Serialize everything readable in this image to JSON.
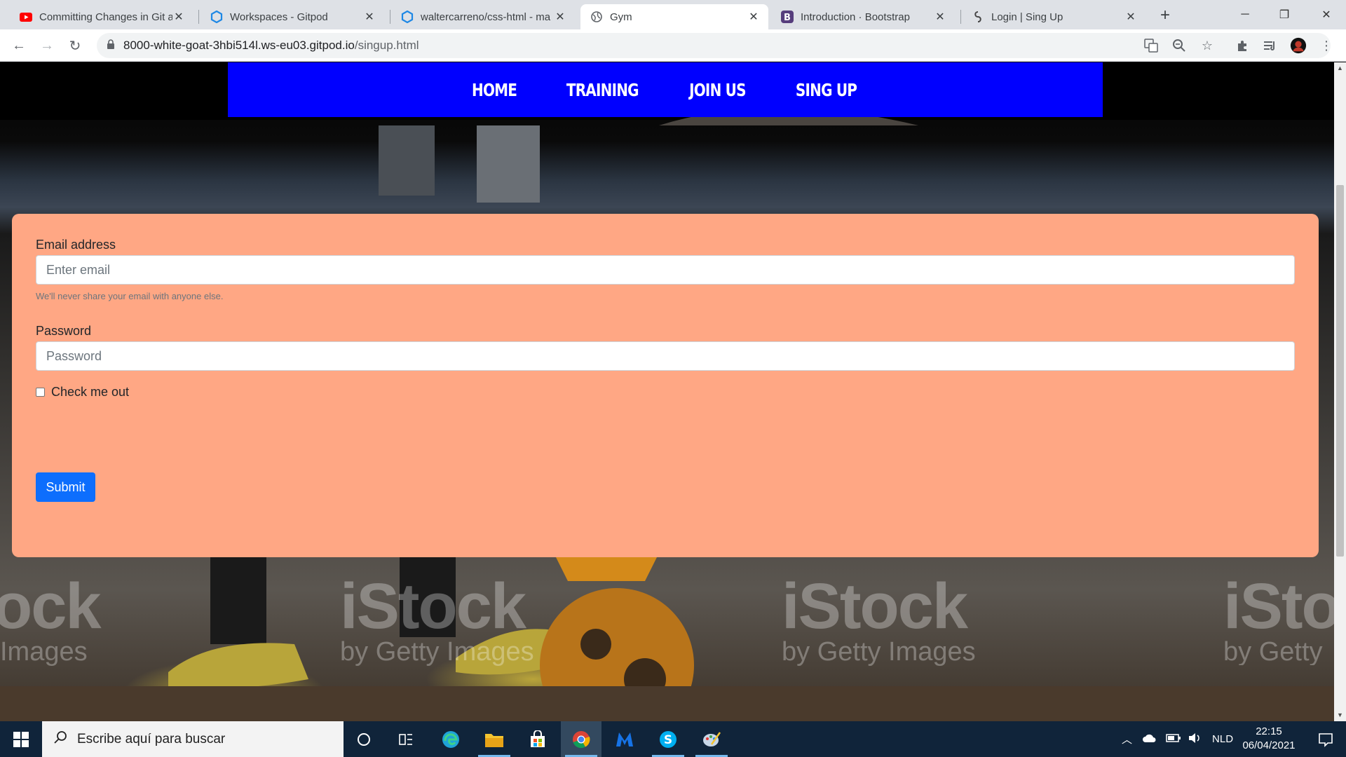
{
  "browser": {
    "tabs": [
      {
        "title": "Committing Changes in Git a",
        "icon": "youtube-icon",
        "active": false
      },
      {
        "title": "Workspaces - Gitpod",
        "icon": "gitpod-icon",
        "active": false
      },
      {
        "title": "waltercarreno/css-html - ma",
        "icon": "gitpod-icon",
        "active": false
      },
      {
        "title": "Gym",
        "icon": "globe-icon",
        "active": true
      },
      {
        "title": "Introduction · Bootstrap",
        "icon": "bootstrap-icon",
        "active": false
      },
      {
        "title": "Login | Sing Up",
        "icon": "site-icon",
        "active": false
      }
    ],
    "url_host": "8000-white-goat-3hbi514l.ws-eu03.gitpod.io",
    "url_path": "/singup.html"
  },
  "page": {
    "nav": [
      "HOME",
      "TRAINING",
      "JOIN US",
      "SING UP"
    ],
    "watermark_brand": "iStock",
    "watermark_sub": "by Getty Images",
    "form": {
      "email_label": "Email address",
      "email_placeholder": "Enter email",
      "email_help": "We'll never share your email with anyone else.",
      "password_label": "Password",
      "password_placeholder": "Password",
      "check_label": "Check me out",
      "submit_label": "Submit"
    },
    "colors": {
      "navbar": "#0000ff",
      "card": "#ffa784",
      "submit": "#0d6efd"
    }
  },
  "taskbar": {
    "search_placeholder": "Escribe aquí para buscar",
    "language": "NLD",
    "time": "22:15",
    "date": "06/04/2021"
  }
}
